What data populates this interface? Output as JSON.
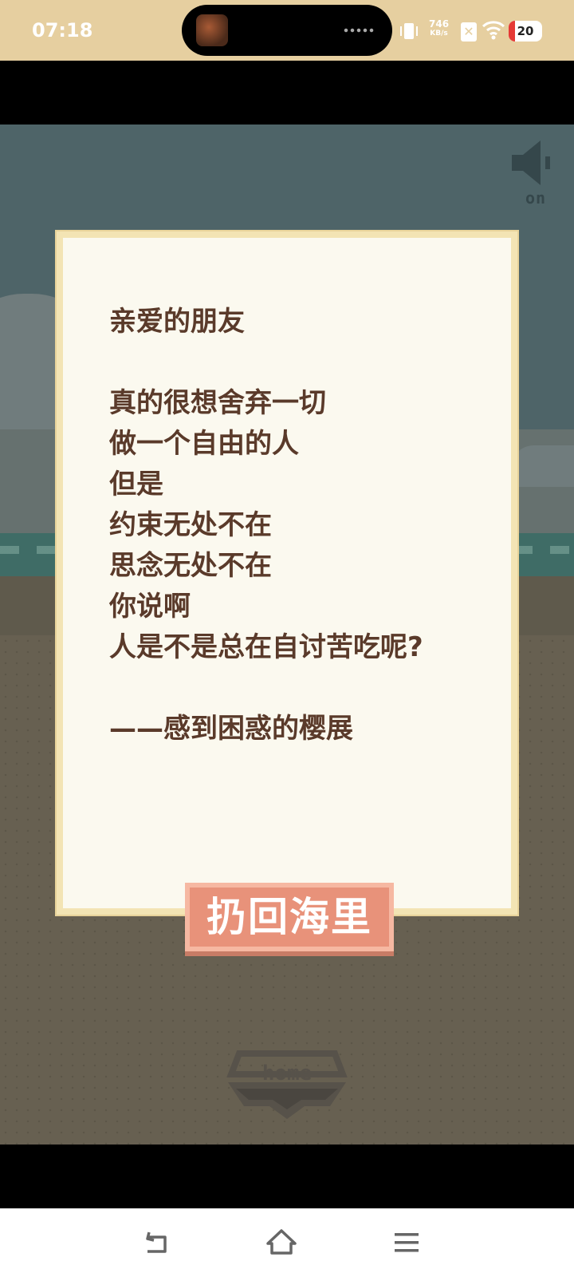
{
  "status_bar": {
    "time": "07:18",
    "net_speed_value": "746",
    "net_speed_unit": "KB/s",
    "battery_level": "20",
    "icons": [
      "vibrate-icon",
      "sim-off-icon",
      "wifi-icon",
      "battery-icon"
    ]
  },
  "game": {
    "sound_toggle": {
      "label": "on",
      "icon": "speaker-icon"
    },
    "letter": {
      "lines": [
        "亲爱的朋友",
        "",
        "真的很想舍弃一切",
        "做一个自由的人",
        "但是",
        "约束无处不在",
        "思念无处不在",
        "你说啊",
        "人是不是总在自讨苦吃呢?",
        "",
        "——感到困惑的樱展"
      ]
    },
    "throw_back_button": "扔回海里",
    "home_button": "home"
  },
  "nav_bar": {
    "items": [
      "back-icon",
      "home-icon",
      "menu-icon"
    ]
  },
  "colors": {
    "status_bar_bg": "#e6cfa0",
    "sky": "#4e6468",
    "sand": "#676051",
    "letter_bg": "#fbf9ef",
    "letter_text": "#5a3a2a",
    "button": "#e8927a"
  }
}
